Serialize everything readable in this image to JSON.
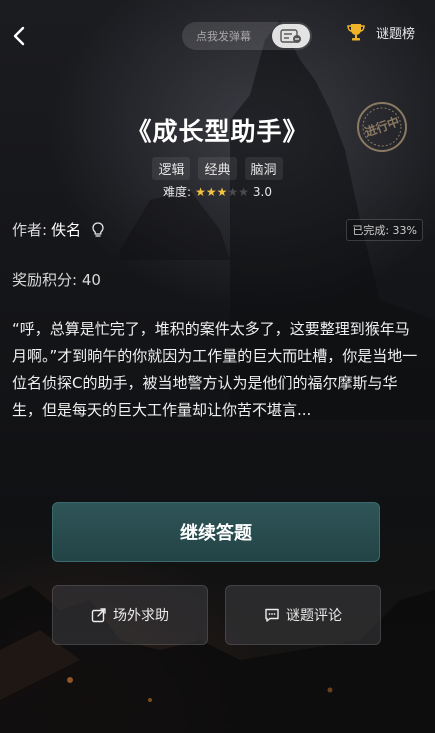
{
  "topbar": {
    "danmu_placeholder": "点我发弹幕",
    "rank_label": "谜题榜"
  },
  "puzzle": {
    "title": "《成长型助手》",
    "status_stamp": "进行中",
    "tags": [
      "逻辑",
      "经典",
      "脑洞"
    ],
    "difficulty_label": "难度:",
    "difficulty_value": "3.0",
    "difficulty_stars": 3,
    "difficulty_max": 5,
    "author_label": "作者:",
    "author_name": "佚名",
    "progress": "已完成: 33%",
    "points": "奖励积分: 40",
    "description": "“呼，总算是忙完了，堆积的案件太多了，这要整理到猴年马月啊。”才到晌午的你就因为工作量的巨大而吐槽，你是当地一位名侦探C的助手，被当地警方认为是他们的福尔摩斯与华生，但是每天的巨大工作量却让你苦不堪言..."
  },
  "actions": {
    "continue": "继续答题",
    "help": "场外求助",
    "comment": "谜题评论"
  },
  "colors": {
    "primary_button": "#2f5558",
    "star_on": "#f3c240",
    "star_off": "#4b4b4f",
    "trophy": "#f0b429"
  },
  "icons": [
    "back-arrow-icon",
    "danmu-toggle-icon",
    "trophy-icon",
    "lightbulb-icon",
    "share-out-icon",
    "comment-icon"
  ]
}
